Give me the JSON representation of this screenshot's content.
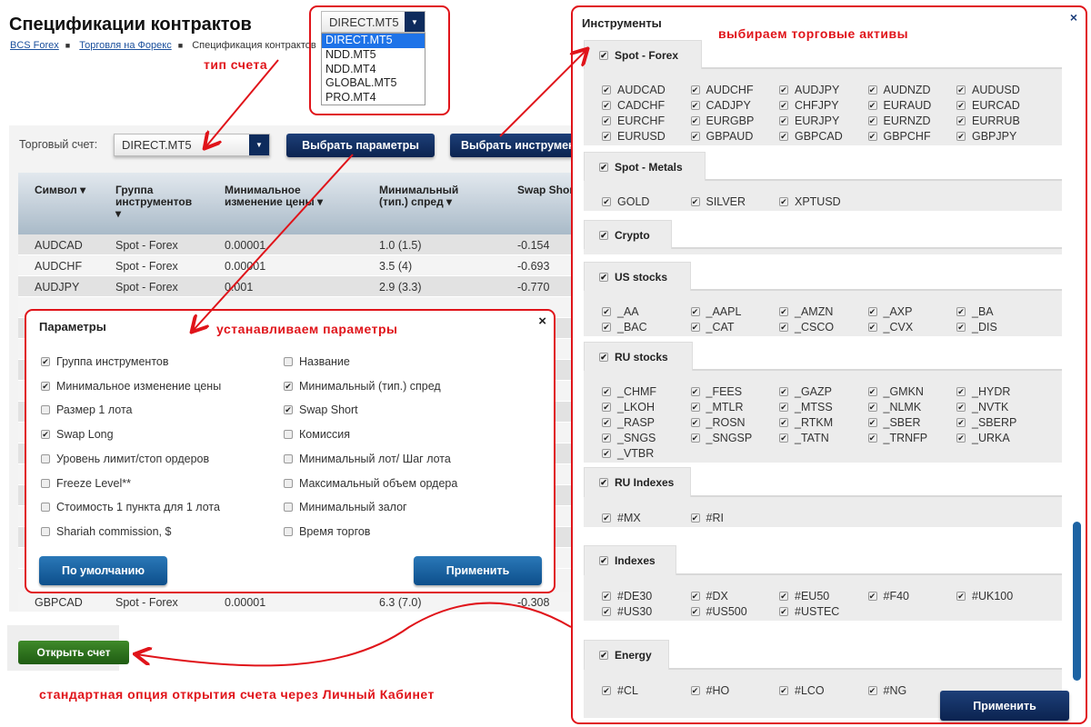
{
  "page": {
    "title": "Спецификации контрактов",
    "breadcrumb": [
      "BCS Forex",
      "Торговля на Форекс",
      "Спецификация контрактов"
    ]
  },
  "account_dropdown": {
    "selected": "DIRECT.MT5",
    "options": [
      "DIRECT.MT5",
      "NDD.MT5",
      "NDD.MT4",
      "GLOBAL.MT5",
      "PRO.MT4"
    ]
  },
  "annotations": {
    "account_type": "тип счета",
    "set_params": "устанавливаем параметры",
    "choose_assets": "выбираем торговые активы",
    "open_account": "стандартная опция открытия счета через Личный Кабинет"
  },
  "annotation_color": "#e0141a",
  "toolbar": {
    "account_label": "Торговый счет:",
    "account_value": "DIRECT.MT5",
    "params_button": "Выбрать параметры",
    "instruments_button": "Выбрать инструменты"
  },
  "table": {
    "headers": [
      "Символ",
      "Группа инструментов",
      "Минимальное изменение цены",
      "Минимальный (тип.) спред",
      "Swap Short"
    ],
    "rows": [
      [
        "AUDCAD",
        "Spot - Forex",
        "0.00001",
        "1.0 (1.5)",
        "-0.154"
      ],
      [
        "AUDCHF",
        "Spot - Forex",
        "0.00001",
        "3.5 (4)",
        "-0.693"
      ],
      [
        "AUDJPY",
        "Spot - Forex",
        "0.001",
        "2.9 (3.3)",
        "-0.770"
      ]
    ],
    "last_row": [
      "GBPCAD",
      "Spot - Forex",
      "0.00001",
      "6.3 (7.0)",
      "-0.308"
    ]
  },
  "params_modal": {
    "title": "Параметры",
    "close": "×",
    "items": [
      {
        "label": "Группа инструментов",
        "checked": true
      },
      {
        "label": "Название",
        "checked": false
      },
      {
        "label": "Минимальное изменение цены",
        "checked": true
      },
      {
        "label": "Минимальный (тип.) спред",
        "checked": true
      },
      {
        "label": "Размер 1 лота",
        "checked": false
      },
      {
        "label": "Swap Short",
        "checked": true
      },
      {
        "label": "Swap Long",
        "checked": true
      },
      {
        "label": "Комиссия",
        "checked": false
      },
      {
        "label": "Уровень лимит/стоп ордеров",
        "checked": false
      },
      {
        "label": "Минимальный лот/ Шаг лота",
        "checked": false
      },
      {
        "label": "Freeze Level**",
        "checked": false
      },
      {
        "label": "Максимальный объем ордера",
        "checked": false
      },
      {
        "label": "Стоимость 1 пункта для 1 лота",
        "checked": false
      },
      {
        "label": "Минимальный залог",
        "checked": false
      },
      {
        "label": "Shariah commission, $",
        "checked": false
      },
      {
        "label": "Время торгов",
        "checked": false
      }
    ],
    "default_button": "По умолчанию",
    "apply_button": "Применить"
  },
  "open_account_button": "Открыть счет",
  "instruments_modal": {
    "title": "Инструменты",
    "close": "×",
    "apply_button": "Применить",
    "scroll_position_percent": 70,
    "groups": [
      {
        "name": "Spot - Forex",
        "checked": true,
        "items": [
          "AUDCAD",
          "AUDCHF",
          "AUDJPY",
          "AUDNZD",
          "AUDUSD",
          "CADCHF",
          "CADJPY",
          "CHFJPY",
          "EURAUD",
          "EURCAD",
          "EURCHF",
          "EURGBP",
          "EURJPY",
          "EURNZD",
          "EURRUB",
          "EURUSD",
          "GBPAUD",
          "GBPCAD",
          "GBPCHF",
          "GBPJPY"
        ]
      },
      {
        "name": "Spot - Metals",
        "checked": true,
        "items": [
          "GOLD",
          "SILVER",
          "XPTUSD"
        ]
      },
      {
        "name": "Crypto",
        "checked": true,
        "items": []
      },
      {
        "name": "US stocks",
        "checked": true,
        "items": [
          "_AA",
          "_AAPL",
          "_AMZN",
          "_AXP",
          "_BA",
          "_BAC",
          "_CAT",
          "_CSCO",
          "_CVX",
          "_DIS"
        ]
      },
      {
        "name": "RU stocks",
        "checked": true,
        "items": [
          "_CHMF",
          "_FEES",
          "_GAZP",
          "_GMKN",
          "_HYDR",
          "_LKOH",
          "_MTLR",
          "_MTSS",
          "_NLMK",
          "_NVTK",
          "_RASP",
          "_ROSN",
          "_RTKM",
          "_SBER",
          "_SBERP",
          "_SNGS",
          "_SNGSP",
          "_TATN",
          "_TRNFP",
          "_URKA",
          "_VTBR"
        ]
      },
      {
        "name": "RU Indexes",
        "checked": true,
        "items": [
          "#MX",
          "#RI"
        ]
      },
      {
        "name": "Indexes",
        "checked": true,
        "items": [
          "#DE30",
          "#DX",
          "#EU50",
          "#F40",
          "#UK100",
          "#US30",
          "#US500",
          "#USTEC"
        ]
      },
      {
        "name": "Energy",
        "checked": true,
        "items": [
          "#CL",
          "#HO",
          "#LCO",
          "#NG"
        ]
      }
    ]
  }
}
